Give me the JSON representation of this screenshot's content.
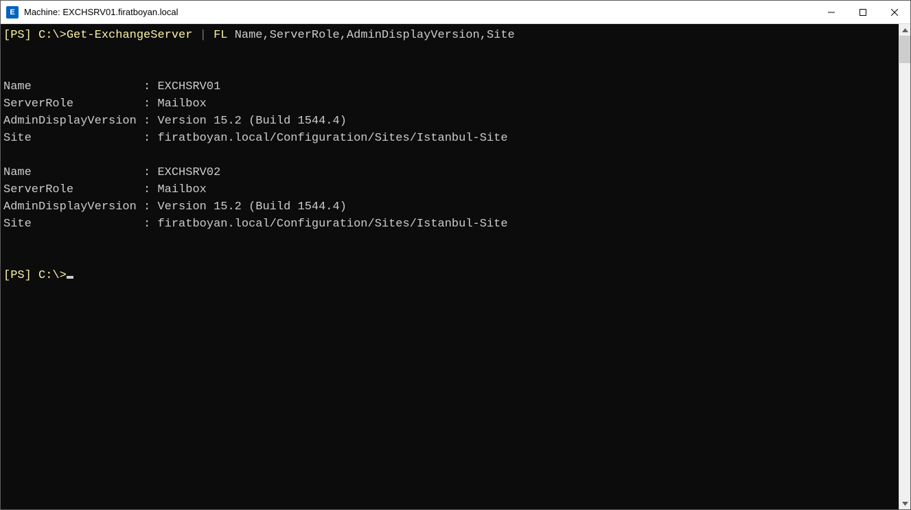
{
  "window": {
    "title": "Machine: EXCHSRV01.firatboyan.local",
    "icon_letter": "E"
  },
  "prompt": {
    "ps_tag": "[PS] ",
    "path": "C:\\>",
    "full_prefix": "[PS] C:\\>"
  },
  "command": {
    "cmdlet": "Get-ExchangeServer",
    "pipe": " | ",
    "format_cmd": "FL",
    "args_space": " ",
    "args": "Name,ServerRole,AdminDisplayVersion,Site"
  },
  "output": {
    "fields": [
      "Name",
      "ServerRole",
      "AdminDisplayVersion",
      "Site"
    ],
    "label_width": 19,
    "separator": " : ",
    "records": [
      {
        "Name": "EXCHSRV01",
        "ServerRole": "Mailbox",
        "AdminDisplayVersion": "Version 15.2 (Build 1544.4)",
        "Site": "firatboyan.local/Configuration/Sites/Istanbul-Site"
      },
      {
        "Name": "EXCHSRV02",
        "ServerRole": "Mailbox",
        "AdminDisplayVersion": "Version 15.2 (Build 1544.4)",
        "Site": "firatboyan.local/Configuration/Sites/Istanbul-Site"
      }
    ]
  }
}
